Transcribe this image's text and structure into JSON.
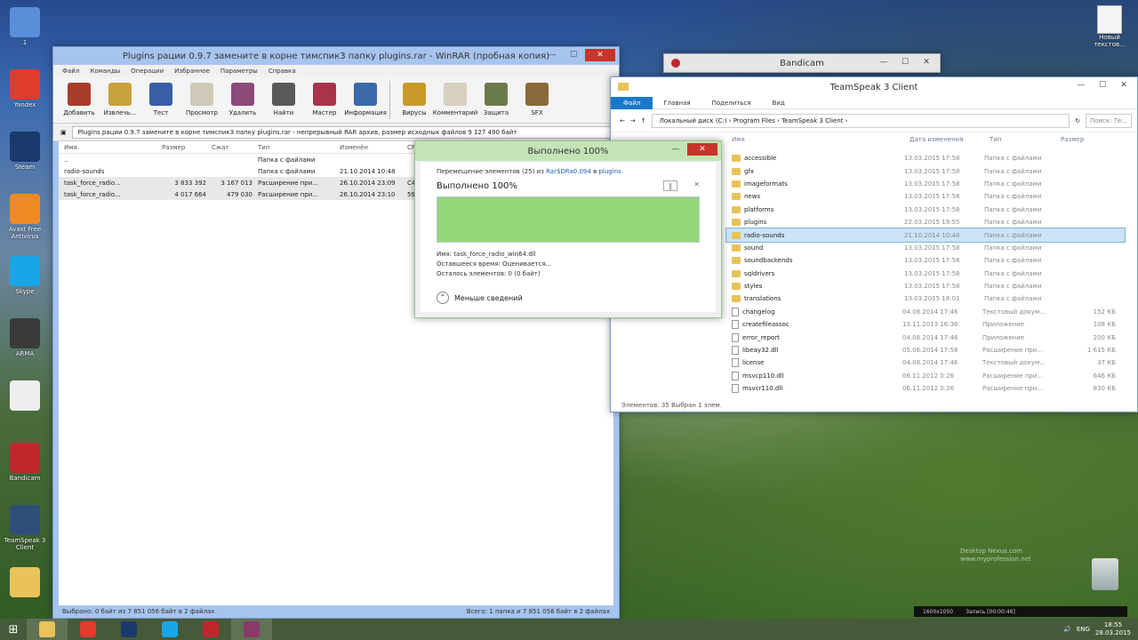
{
  "desktop": {
    "left_icons": [
      {
        "label": "1",
        "name": "this-pc-icon",
        "color": "#5a8ed8"
      },
      {
        "label": "Yandex",
        "name": "yandex-icon",
        "color": "#e03c2e"
      },
      {
        "label": "Steam",
        "name": "steam-icon",
        "color": "#1b3a6b"
      },
      {
        "label": "Avast Free Antivirus",
        "name": "avast-icon",
        "color": "#f08a24"
      },
      {
        "label": "Skype",
        "name": "skype-icon",
        "color": "#1aa5e6"
      },
      {
        "label": "ARMA",
        "name": "arma-icon",
        "color": "#3a3a3a"
      },
      {
        "label": "",
        "name": "document-icon",
        "color": "#eeeeee"
      },
      {
        "label": "Bandicam",
        "name": "bandicam-icon",
        "color": "#c0272d"
      },
      {
        "label": "TeamSpeak 3 Client",
        "name": "teamspeak-icon",
        "color": "#2f4f7a"
      },
      {
        "label": "",
        "name": "folder-icon",
        "color": "#e9c35a"
      }
    ],
    "right_icon_label": "Новый текстов...",
    "watermark_line1": "Desktop Nexus.com",
    "watermark_line2": "www.myprofession.net"
  },
  "winrar": {
    "title": "Plugins рации 0.9.7 замените в корне тимспик3 папку plugins.rar - WinRAR (пробная копия)",
    "menu": [
      "Файл",
      "Команды",
      "Операции",
      "Избранное",
      "Параметры",
      "Справка"
    ],
    "toolbar": [
      {
        "label": "Добавить",
        "name": "add-button",
        "color": "#a83c2a"
      },
      {
        "label": "Извлечь...",
        "name": "extract-button",
        "color": "#c8a23a"
      },
      {
        "label": "Тест",
        "name": "test-button",
        "color": "#3a5ea8"
      },
      {
        "label": "Просмотр",
        "name": "view-button",
        "color": "#cfc9b8"
      },
      {
        "label": "Удалить",
        "name": "delete-button",
        "color": "#8a4a7a"
      },
      {
        "label": "Найти",
        "name": "find-button",
        "color": "#5a5a5a"
      },
      {
        "label": "Мастер",
        "name": "wizard-button",
        "color": "#a8344a"
      },
      {
        "label": "Информация",
        "name": "info-button",
        "color": "#3a6aa8"
      },
      {
        "label": "Вирусы",
        "name": "virus-scan-button",
        "color": "#c89a2a"
      },
      {
        "label": "Комментарий",
        "name": "comment-button",
        "color": "#d8d0c0"
      },
      {
        "label": "Защита",
        "name": "protect-button",
        "color": "#6a7a4a"
      },
      {
        "label": "SFX",
        "name": "sfx-button",
        "color": "#8a6a3a"
      }
    ],
    "path": "Plugins рации 0.9.7 замените в корне тимспик3 папку plugins.rar - непрерывный RAR архив, размер исходных файлов 9 127 490 байт",
    "columns": [
      "Имя",
      "Размер",
      "Сжат",
      "Тип",
      "Изменён",
      "CR"
    ],
    "rows": [
      {
        "name": "..",
        "size": "",
        "packed": "",
        "type": "Папка с файлами",
        "modified": "",
        "crc": "",
        "icon": "folder"
      },
      {
        "name": "radio-sounds",
        "size": "",
        "packed": "",
        "type": "Папка с файлами",
        "modified": "21.10.2014 10:48",
        "crc": "",
        "icon": "folder"
      },
      {
        "name": "task_force_radio...",
        "size": "3 833 392",
        "packed": "3 167 013",
        "type": "Расширение при...",
        "modified": "26.10.2014 23:09",
        "crc": "C4",
        "icon": "file"
      },
      {
        "name": "task_force_radio...",
        "size": "4 017 664",
        "packed": "479 030",
        "type": "Расширение при...",
        "modified": "26.10.2014 23:10",
        "crc": "59",
        "icon": "file"
      }
    ],
    "status_left": "Выбрано: 0 байт из 7 851 056 байт в 2 файлах",
    "status_right": "Всего: 1 папка и 7 851 056 байт в 2 файлах"
  },
  "bandicam": {
    "title": "Bandicam"
  },
  "explorer": {
    "title": "TeamSpeak 3 Client",
    "ribbon_file": "Файл",
    "ribbon_tabs": [
      "Главная",
      "Поделиться",
      "Вид"
    ],
    "breadcrumb": [
      "Локальный диск (C:)",
      "Program Files",
      "TeamSpeak 3 Client"
    ],
    "search_placeholder": "Поиск: Те...",
    "columns": [
      "Имя",
      "Дата изменения",
      "Тип",
      "Размер"
    ],
    "rows": [
      {
        "name": "accessible",
        "date": "13.03.2015 17:58",
        "type": "Папка с файлами",
        "size": "",
        "icon": "folder"
      },
      {
        "name": "gfx",
        "date": "13.03.2015 17:58",
        "type": "Папка с файлами",
        "size": "",
        "icon": "folder"
      },
      {
        "name": "imageformats",
        "date": "13.03.2015 17:58",
        "type": "Папка с файлами",
        "size": "",
        "icon": "folder"
      },
      {
        "name": "news",
        "date": "13.03.2015 17:58",
        "type": "Папка с файлами",
        "size": "",
        "icon": "folder"
      },
      {
        "name": "platforms",
        "date": "13.03.2015 17:58",
        "type": "Папка с файлами",
        "size": "",
        "icon": "folder"
      },
      {
        "name": "plugins",
        "date": "22.03.2015 19:55",
        "type": "Папка с файлами",
        "size": "",
        "icon": "folder"
      },
      {
        "name": "radio-sounds",
        "date": "21.10.2014 10:48",
        "type": "Папка с файлами",
        "size": "",
        "icon": "folder",
        "selected": true
      },
      {
        "name": "sound",
        "date": "13.03.2015 17:58",
        "type": "Папка с файлами",
        "size": "",
        "icon": "folder"
      },
      {
        "name": "soundbackends",
        "date": "13.03.2015 17:58",
        "type": "Папка с файлами",
        "size": "",
        "icon": "folder"
      },
      {
        "name": "sqldrivers",
        "date": "13.03.2015 17:58",
        "type": "Папка с файлами",
        "size": "",
        "icon": "folder"
      },
      {
        "name": "styles",
        "date": "13.03.2015 17:58",
        "type": "Папка с файлами",
        "size": "",
        "icon": "folder"
      },
      {
        "name": "translations",
        "date": "13.03.2015 18:01",
        "type": "Папка с файлами",
        "size": "",
        "icon": "folder"
      },
      {
        "name": "changelog",
        "date": "04.08.2014 17:46",
        "type": "Текстовый докум...",
        "size": "152 КБ",
        "icon": "file"
      },
      {
        "name": "createfileassoc",
        "date": "13.11.2013 16:36",
        "type": "Приложение",
        "size": "108 КБ",
        "icon": "file"
      },
      {
        "name": "error_report",
        "date": "04.08.2014 17:46",
        "type": "Приложение",
        "size": "200 КБ",
        "icon": "file"
      },
      {
        "name": "libeay32.dll",
        "date": "05.06.2014 17:58",
        "type": "Расширение при...",
        "size": "1 615 КБ",
        "icon": "file"
      },
      {
        "name": "license",
        "date": "04.08.2014 17:46",
        "type": "Текстовый докум...",
        "size": "37 КБ",
        "icon": "file"
      },
      {
        "name": "msvcp110.dll",
        "date": "06.11.2012 0:26",
        "type": "Расширение при...",
        "size": "646 КБ",
        "icon": "file"
      },
      {
        "name": "msvcr110.dll",
        "date": "06.11.2012 0:26",
        "type": "Расширение при...",
        "size": "830 КБ",
        "icon": "file"
      }
    ],
    "status": "Элементов: 35    Выбран 1 элем."
  },
  "progress": {
    "title": "Выполнено 100%",
    "line_prefix": "Перемещение элементов (25) из",
    "line_source": "Rar$DRa0.094",
    "line_mid": "в",
    "line_dest": "plugins",
    "percent_label": "Выполнено 100%",
    "percent": 100,
    "name_line": "Имя: task_force_radio_win64.dll",
    "time_line": "Оставшееся время: Оценивается...",
    "items_line": "Осталось элементов: 0 (0 байт)",
    "less_details": "Меньше сведений",
    "bar_color": "#93d77a"
  },
  "taskbar": {
    "apps": [
      {
        "name": "taskbar-explorer-icon",
        "color": "#e9c35a"
      },
      {
        "name": "taskbar-yandex-icon",
        "color": "#e03c2e"
      },
      {
        "name": "taskbar-steam-icon",
        "color": "#1b3a6b"
      },
      {
        "name": "taskbar-skype-icon",
        "color": "#1aa5e6"
      },
      {
        "name": "taskbar-bandicam-icon",
        "color": "#c0272d"
      },
      {
        "name": "taskbar-winrar-icon",
        "color": "#8a3a6a"
      }
    ],
    "lang": "ENG",
    "time": "18:55",
    "date": "28.03.2015"
  },
  "bandicam_overlay": {
    "resolution": "1600x1050",
    "recording": "Запись [00:00:46]"
  }
}
